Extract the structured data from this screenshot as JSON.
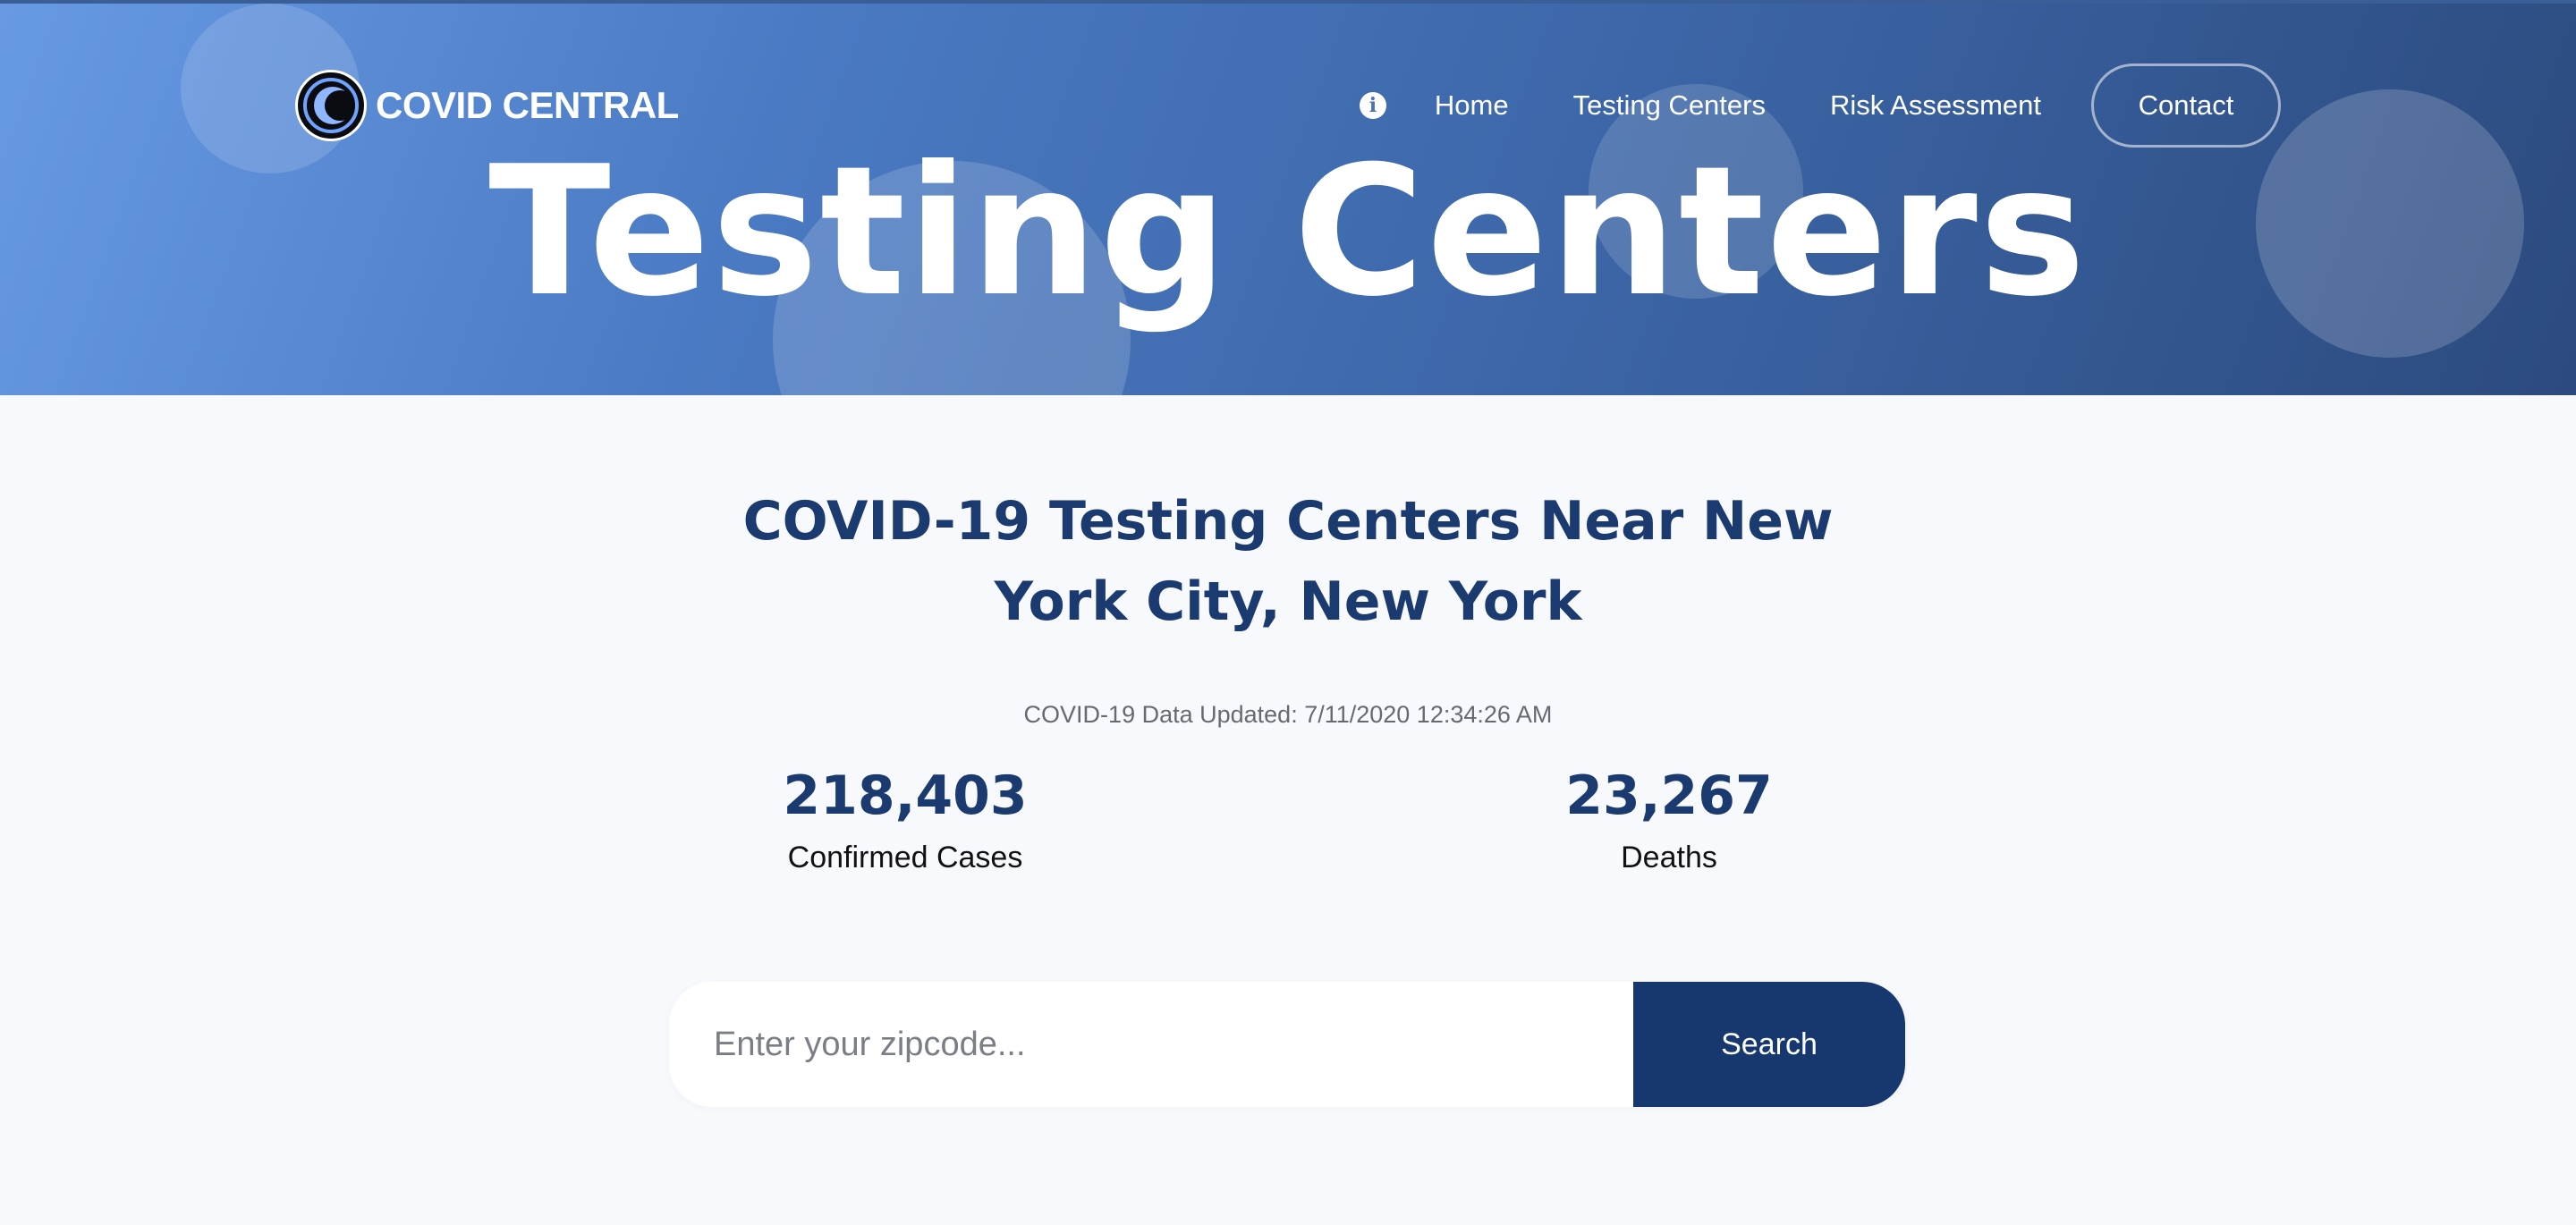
{
  "brand": {
    "name": "COVID CENTRAL",
    "logo_icon": "crescent-logo-icon"
  },
  "nav": {
    "info_icon": "info-circle-icon",
    "info_glyph": "i",
    "items": [
      {
        "label": "Home"
      },
      {
        "label": "Testing Centers"
      },
      {
        "label": "Risk Assessment"
      }
    ],
    "contact_label": "Contact"
  },
  "hero": {
    "title": "Testing Centers"
  },
  "main": {
    "heading": "COVID-19 Testing Centers Near New York City, New York",
    "updated": "COVID-19 Data Updated: 7/11/2020 12:34:26 AM",
    "stats": {
      "cases": {
        "value": "218,403",
        "label": "Confirmed Cases"
      },
      "deaths": {
        "value": "23,267",
        "label": "Deaths"
      }
    }
  },
  "search": {
    "placeholder": "Enter your zipcode...",
    "value": "",
    "button_label": "Search"
  },
  "colors": {
    "primary_dark": "#17376f",
    "heading": "#1a3a70",
    "hero_gradient_start": "#6899e4",
    "hero_gradient_end": "#2c4a7e",
    "page_bg": "#f7f9fd"
  }
}
